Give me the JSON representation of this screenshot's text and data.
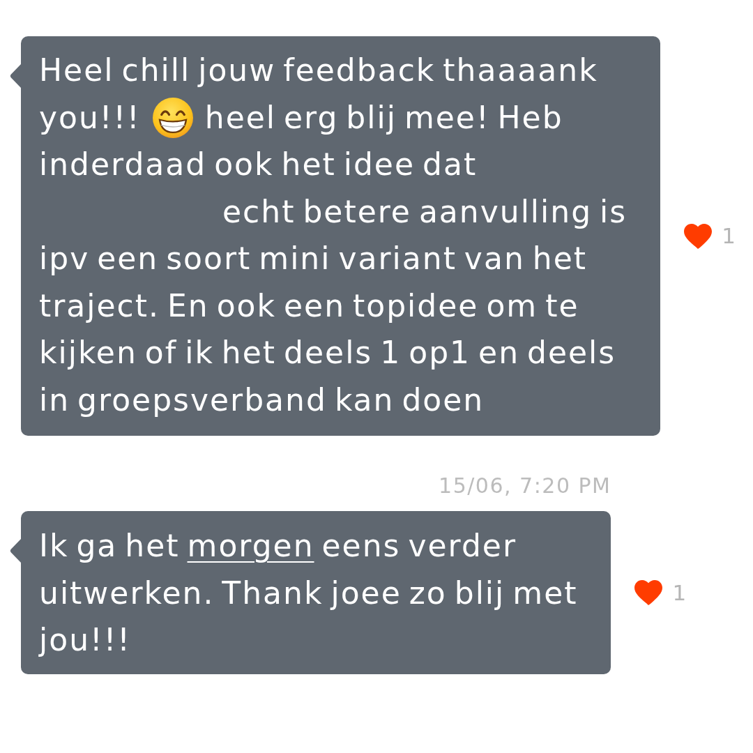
{
  "messages": [
    {
      "lines": [
        {
          "parts": [
            {
              "kind": "text",
              "text": "Heel chill jouw feedback thaaaank"
            }
          ]
        },
        {
          "parts": [
            {
              "kind": "text",
              "text": "you!!!"
            },
            {
              "kind": "emoji"
            },
            {
              "kind": "text",
              "text": "heel erg blij mee! Heb"
            }
          ]
        },
        {
          "parts": [
            {
              "kind": "text",
              "text": "inderdaad ook het idee dat"
            }
          ]
        },
        {
          "parts": [
            {
              "kind": "blank"
            },
            {
              "kind": "text",
              "text": "echt betere aanvulling is"
            }
          ]
        },
        {
          "parts": [
            {
              "kind": "text",
              "text": "ipv een soort mini variant van het"
            }
          ]
        },
        {
          "parts": [
            {
              "kind": "text",
              "text": "traject. En ook een topidee om te"
            }
          ]
        },
        {
          "parts": [
            {
              "kind": "text",
              "text": "kijken of ik het deels 1 op1 en deels"
            }
          ]
        },
        {
          "parts": [
            {
              "kind": "text",
              "text": "in groepsverband kan doen"
            }
          ]
        }
      ],
      "reaction": {
        "count": "1"
      }
    },
    {
      "timestamp": "15/06, 7:20 PM",
      "lines": [
        {
          "parts": [
            {
              "kind": "text",
              "text": "Ik ga het"
            },
            {
              "kind": "link",
              "text": "morgen"
            },
            {
              "kind": "text",
              "text": "eens verder"
            }
          ]
        },
        {
          "parts": [
            {
              "kind": "text",
              "text": "uitwerken. Thank joee zo blij met"
            }
          ]
        },
        {
          "parts": [
            {
              "kind": "text",
              "text": "jou!!!"
            }
          ]
        }
      ],
      "reaction": {
        "count": "1"
      }
    }
  ]
}
